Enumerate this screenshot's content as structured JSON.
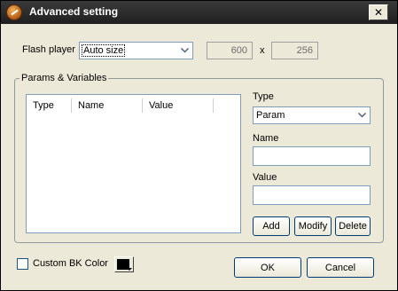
{
  "window": {
    "title": "Advanced setting",
    "close_symbol": "✕"
  },
  "flash_player": {
    "label": "Flash player",
    "selected": "Auto size",
    "width_value": "600",
    "separator": "x",
    "height_value": "256"
  },
  "params": {
    "group_label": "Params & Variables",
    "columns": [
      "Type",
      "Name",
      "Value"
    ],
    "type_label": "Type",
    "type_selected": "Param",
    "name_label": "Name",
    "name_value": "",
    "value_label": "Value",
    "value_value": "",
    "add_label": "Add",
    "modify_label": "Modify",
    "delete_label": "Delete"
  },
  "footer": {
    "custom_bk_label": "Custom BK Color",
    "custom_bk_checked": false,
    "bk_color": "#000000",
    "ok_label": "OK",
    "cancel_label": "Cancel"
  },
  "icons": {
    "app": "app-logo-icon",
    "close": "close-icon",
    "dropdown": "chevron-down-icon"
  }
}
